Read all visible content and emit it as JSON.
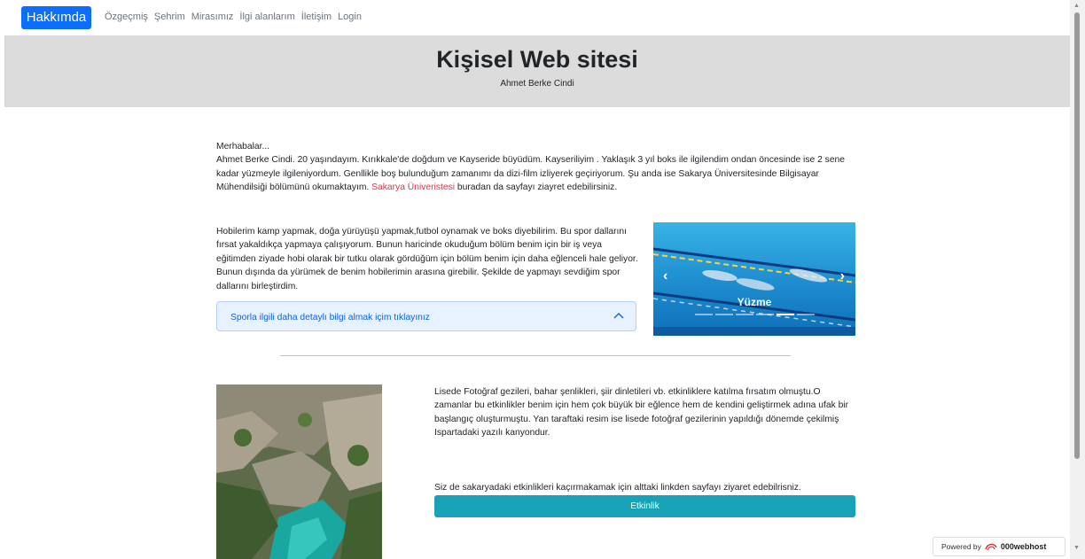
{
  "nav": {
    "brand": "Hakkımda",
    "links": [
      "Özgeçmiş",
      "Şehrim",
      "Mirasımız",
      "İlgi alanlarım",
      "İletişim",
      "Login"
    ]
  },
  "header": {
    "title": "Kişisel Web sitesi",
    "subtitle": "Ahmet Berke Cindi"
  },
  "intro": {
    "greeting": "Merhabalar...",
    "text": "Ahmet Berke Cindi. 20 yaşındayım. Kırıkkale'de doğdum ve Kayseride büyüdüm. Kayseriliyim . Yaklaşık 3 yıl boks ile ilgilendim ondan öncesinde ise 2 sene kadar yüzmeyle ilgileniyordum. Genllikle boş bulunduğum zamanımı da dizi-film izliyerek geçiriyorum. Şu anda ise Sakarya Üniversitesinde Bilgisayar Mühendilsiği bölümünü okumaktayım.",
    "link_text": "Sakarya Üniveristesi",
    "after_link": "buradan da sayfayı ziayret edebilirsiniz."
  },
  "hobbies": {
    "text": "Hobilerim kamp yapmak, doğa yürüyüşü yapmak,futbol oynamak ve boks diyebilirim. Bu spor dallarını fırsat yakaldıkça yapmaya çalışıyorum. Bunun haricinde okuduğum bölüm benim için bir iş veya eğitimden ziyade hobi olarak bir tutku olarak gördüğüm için bölüm benim için daha eğlenceli hale geliyor. Bunun dışında da yürümek de benim hobilerimin arasına girebilir. Şekilde de yapmayı sevdiğim spor dallarını birleştirdim.",
    "accordion_label": "Sporla ilgili daha detaylı bilgi almak içim tıklayınız"
  },
  "carousel": {
    "caption": "Yüzme",
    "slide_count": 6,
    "active_index": 4
  },
  "trip": {
    "text": "Lisede Fotoğraf gezileri, bahar şenlikleri, şiir dinletileri vb. etkinliklere katılma fırsatım olmuştu.O zamanlar bu etkinlikler benim için hem çok büyük bir eğlence hem de kendini geliştirmek adına ufak bir başlangıç oluşturmuştu. Yan taraftaki resim ise lisede fotoğraf gezilerinin yapıldığı dönemde çekilmiş Ispartadaki yazılı kanyondur.",
    "invite": "Siz de sakaryadaki etkinlikleri kaçırmakamak için alttaki linkden sayfayı ziyaret edebilrisniz.",
    "button": "Etkinlik"
  },
  "badge": {
    "prefix": "Powered by",
    "brand": "000webhost"
  },
  "colors": {
    "primary": "#0d6efd",
    "header_bg": "#dcdcdc",
    "link_red": "#dc3545",
    "accordion_bg": "#e7f1ff",
    "button_teal": "#17a2b8",
    "divider": "#f1b0b7"
  }
}
